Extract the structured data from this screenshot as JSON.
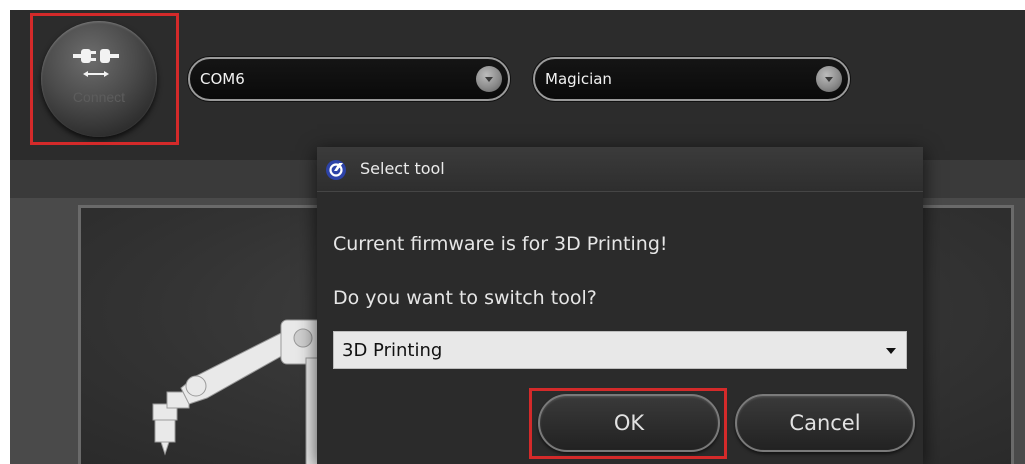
{
  "toolbar": {
    "connect_label": "Connect",
    "port": {
      "value": "COM6"
    },
    "device": {
      "value": "Magician"
    }
  },
  "dialog": {
    "title": "Select tool",
    "message": "Current firmware is for 3D Printing!",
    "question": "Do you want to switch tool?",
    "selected_tool": "3D Printing",
    "ok_label": "OK",
    "cancel_label": "Cancel"
  },
  "colors": {
    "highlight": "#d42a2a",
    "background": "#2e2e2e",
    "logo": "#2d43a8"
  },
  "icons": {
    "connect": "plug-icon",
    "logo": "dobot-logo-icon",
    "dropdown": "chevron-down-icon"
  }
}
